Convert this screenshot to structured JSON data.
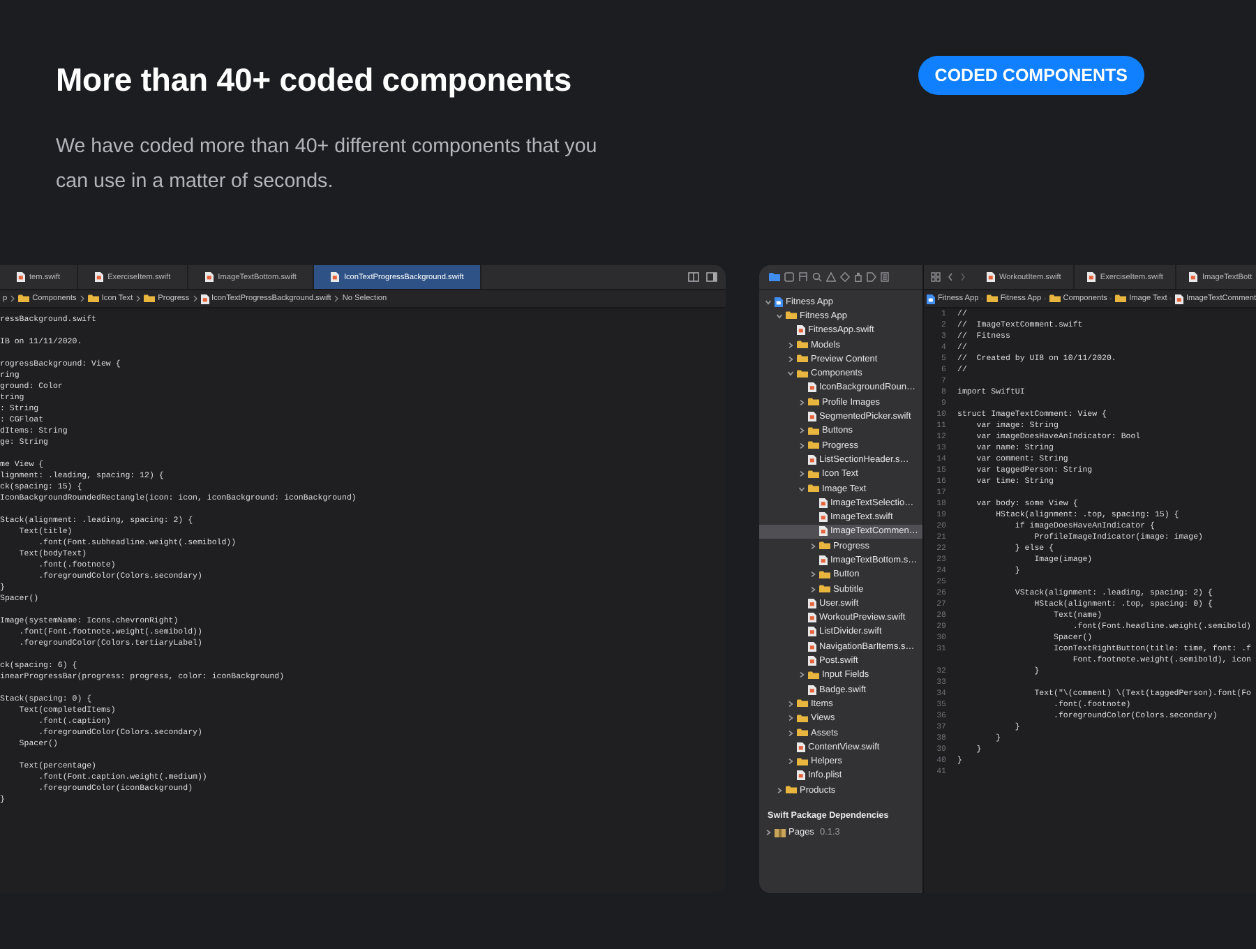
{
  "header": {
    "title": "More than 40+ coded components",
    "description": "We have coded more than 40+ different components that you can use in a matter of seconds.",
    "badge": "CODED COMPONENTS"
  },
  "left_editor": {
    "tabs": [
      {
        "label": "tem.swift",
        "selected": false
      },
      {
        "label": "ExerciseItem.swift",
        "selected": false
      },
      {
        "label": "ImageTextBottom.swift",
        "selected": false
      },
      {
        "label": "IconTextProgressBackground.swift",
        "selected": true
      }
    ],
    "breadcrumb": [
      {
        "kind": "text",
        "label": "p"
      },
      {
        "kind": "folder",
        "label": "Components"
      },
      {
        "kind": "folder",
        "label": "Icon Text"
      },
      {
        "kind": "folder",
        "label": "Progress"
      },
      {
        "kind": "file",
        "label": "IconTextProgressBackground.swift"
      },
      {
        "kind": "text",
        "label": "No Selection"
      }
    ],
    "code_blocks": [
      [
        "ressBackground.swift"
      ],
      [
        "IB on 11/11/2020."
      ],
      [
        "rogressBackground: View {",
        "ring",
        "ground: Color",
        "tring",
        ": String",
        ": CGFloat",
        "dItems: String",
        "ge: String"
      ],
      [
        "me View {",
        "lignment: .leading, spacing: 12) {",
        "ck(spacing: 15) {",
        "IconBackgroundRoundedRectangle(icon: icon, iconBackground: iconBackground)"
      ],
      [
        "Stack(alignment: .leading, spacing: 2) {",
        "    Text(title)",
        "        .font(Font.subheadline.weight(.semibold))",
        "    Text(bodyText)",
        "        .font(.footnote)",
        "        .foregroundColor(Colors.secondary)",
        "}",
        "Spacer()"
      ],
      [
        "Image(systemName: Icons.chevronRight)",
        "    .font(Font.footnote.weight(.semibold))",
        "    .foregroundColor(Colors.tertiaryLabel)"
      ],
      [
        "ck(spacing: 6) {",
        "inearProgressBar(progress: progress, color: iconBackground)"
      ],
      [
        "Stack(spacing: 0) {",
        "    Text(completedItems)",
        "        .font(.caption)",
        "        .foregroundColor(Colors.secondary)",
        "    Spacer()"
      ],
      [
        "    Text(percentage)",
        "        .font(Font.caption.weight(.medium))",
        "        .foregroundColor(iconBackground)",
        "}"
      ]
    ]
  },
  "right_editor": {
    "navigator": {
      "tree": [
        {
          "kind": "project",
          "label": "Fitness App",
          "expanded": true,
          "selected": false,
          "children": [
            {
              "kind": "folder",
              "label": "Fitness App",
              "expanded": true,
              "selected": false,
              "children": [
                {
                  "kind": "file",
                  "label": "FitnessApp.swift",
                  "selected": false
                },
                {
                  "kind": "folder",
                  "label": "Models",
                  "expanded": false,
                  "selected": false
                },
                {
                  "kind": "folder",
                  "label": "Preview Content",
                  "expanded": false,
                  "selected": false
                },
                {
                  "kind": "folder",
                  "label": "Components",
                  "expanded": true,
                  "selected": false,
                  "children": [
                    {
                      "kind": "file",
                      "label": "IconBackgroundRoun…",
                      "selected": false
                    },
                    {
                      "kind": "folder",
                      "label": "Profile Images",
                      "expanded": false,
                      "selected": false
                    },
                    {
                      "kind": "file",
                      "label": "SegmentedPicker.swift",
                      "selected": false
                    },
                    {
                      "kind": "folder",
                      "label": "Buttons",
                      "expanded": false,
                      "selected": false
                    },
                    {
                      "kind": "folder",
                      "label": "Progress",
                      "expanded": false,
                      "selected": false
                    },
                    {
                      "kind": "file",
                      "label": "ListSectionHeader.s…",
                      "selected": false
                    },
                    {
                      "kind": "folder",
                      "label": "Icon Text",
                      "expanded": false,
                      "selected": false
                    },
                    {
                      "kind": "folder",
                      "label": "Image Text",
                      "expanded": true,
                      "selected": false,
                      "children": [
                        {
                          "kind": "file",
                          "label": "ImageTextSelectio…",
                          "selected": false
                        },
                        {
                          "kind": "file",
                          "label": "ImageText.swift",
                          "selected": false
                        },
                        {
                          "kind": "file",
                          "label": "ImageTextCommen…",
                          "selected": true
                        },
                        {
                          "kind": "folder",
                          "label": "Progress",
                          "expanded": false,
                          "selected": false
                        },
                        {
                          "kind": "file",
                          "label": "ImageTextBottom.s…",
                          "selected": false
                        },
                        {
                          "kind": "folder",
                          "label": "Button",
                          "expanded": false,
                          "selected": false
                        },
                        {
                          "kind": "folder",
                          "label": "Subtitle",
                          "expanded": false,
                          "selected": false
                        }
                      ]
                    },
                    {
                      "kind": "file",
                      "label": "User.swift",
                      "selected": false
                    },
                    {
                      "kind": "file",
                      "label": "WorkoutPreview.swift",
                      "selected": false
                    },
                    {
                      "kind": "file",
                      "label": "ListDivider.swift",
                      "selected": false
                    },
                    {
                      "kind": "file",
                      "label": "NavigationBarItems.s…",
                      "selected": false
                    },
                    {
                      "kind": "file",
                      "label": "Post.swift",
                      "selected": false
                    },
                    {
                      "kind": "folder",
                      "label": "Input Fields",
                      "expanded": false,
                      "selected": false
                    },
                    {
                      "kind": "file",
                      "label": "Badge.swift",
                      "selected": false
                    }
                  ]
                },
                {
                  "kind": "folder",
                  "label": "Items",
                  "expanded": false,
                  "selected": false
                },
                {
                  "kind": "folder",
                  "label": "Views",
                  "expanded": false,
                  "selected": false
                },
                {
                  "kind": "folder",
                  "label": "Assets",
                  "expanded": false,
                  "selected": false
                },
                {
                  "kind": "file",
                  "label": "ContentView.swift",
                  "selected": false
                },
                {
                  "kind": "folder",
                  "label": "Helpers",
                  "expanded": false,
                  "selected": false
                },
                {
                  "kind": "file",
                  "label": "Info.plist",
                  "selected": false
                }
              ]
            },
            {
              "kind": "folder",
              "label": "Products",
              "expanded": false,
              "selected": false
            }
          ]
        }
      ],
      "dependencies_title": "Swift Package Dependencies",
      "packages": [
        {
          "name": "Pages",
          "version": "0.1.3",
          "expanded": false
        }
      ]
    },
    "tabs": [
      {
        "label": "WorkoutItem.swift",
        "selected": false
      },
      {
        "label": "ExerciseItem.swift",
        "selected": false
      },
      {
        "label": "ImageTextBott",
        "selected": false
      }
    ],
    "breadcrumb": [
      {
        "kind": "project",
        "label": "Fitness App"
      },
      {
        "kind": "folder",
        "label": "Fitness App"
      },
      {
        "kind": "folder",
        "label": "Components"
      },
      {
        "kind": "folder",
        "label": "Image Text"
      },
      {
        "kind": "file",
        "label": "ImageTextComment"
      }
    ],
    "lines": [
      {
        "number": "1",
        "text": "//"
      },
      {
        "number": "2",
        "text": "//  ImageTextComment.swift"
      },
      {
        "number": "3",
        "text": "//  Fitness"
      },
      {
        "number": "4",
        "text": "//"
      },
      {
        "number": "5",
        "text": "//  Created by UI8 on 10/11/2020."
      },
      {
        "number": "6",
        "text": "//"
      },
      {
        "number": "7"
      },
      {
        "number": "8",
        "text": "import SwiftUI"
      },
      {
        "number": "9"
      },
      {
        "number": "10",
        "text": "struct ImageTextComment: View {"
      },
      {
        "number": "11",
        "text": "    var image: String"
      },
      {
        "number": "12",
        "text": "    var imageDoesHaveAnIndicator: Bool"
      },
      {
        "number": "13",
        "text": "    var name: String"
      },
      {
        "number": "14",
        "text": "    var comment: String"
      },
      {
        "number": "15",
        "text": "    var taggedPerson: String"
      },
      {
        "number": "16",
        "text": "    var time: String"
      },
      {
        "number": "17"
      },
      {
        "number": "18",
        "text": "    var body: some View {"
      },
      {
        "number": "19",
        "text": "        HStack(alignment: .top, spacing: 15) {"
      },
      {
        "number": "20",
        "text": "            if imageDoesHaveAnIndicator {"
      },
      {
        "number": "21",
        "text": "                ProfileImageIndicator(image: image)"
      },
      {
        "number": "22",
        "text": "            } else {"
      },
      {
        "number": "23",
        "text": "                Image(image)"
      },
      {
        "number": "24",
        "text": "            }"
      },
      {
        "number": "25"
      },
      {
        "number": "26",
        "text": "            VStack(alignment: .leading, spacing: 2) {"
      },
      {
        "number": "27",
        "text": "                HStack(alignment: .top, spacing: 0) {"
      },
      {
        "number": "28",
        "text": "                    Text(name)"
      },
      {
        "number": "29",
        "text": "                        .font(Font.headline.weight(.semibold)"
      },
      {
        "number": "30",
        "text": "                    Spacer()"
      },
      {
        "number": "31",
        "text": "                    IconTextRightButton(title: time, font: .f"
      },
      {
        "text": "                        Font.footnote.weight(.semibold), icon"
      },
      {
        "number": "32",
        "text": "                }"
      },
      {
        "number": "33"
      },
      {
        "number": "34",
        "text": "                Text(\"\\(comment) \\(Text(taggedPerson).font(Fo"
      },
      {
        "number": "35",
        "text": "                    .font(.footnote)"
      },
      {
        "number": "36",
        "text": "                    .foregroundColor(Colors.secondary)"
      },
      {
        "number": "37",
        "text": "            }"
      },
      {
        "number": "38",
        "text": "        }"
      },
      {
        "number": "39",
        "text": "    }"
      },
      {
        "number": "40",
        "text": "}"
      },
      {
        "number": "41"
      }
    ]
  }
}
